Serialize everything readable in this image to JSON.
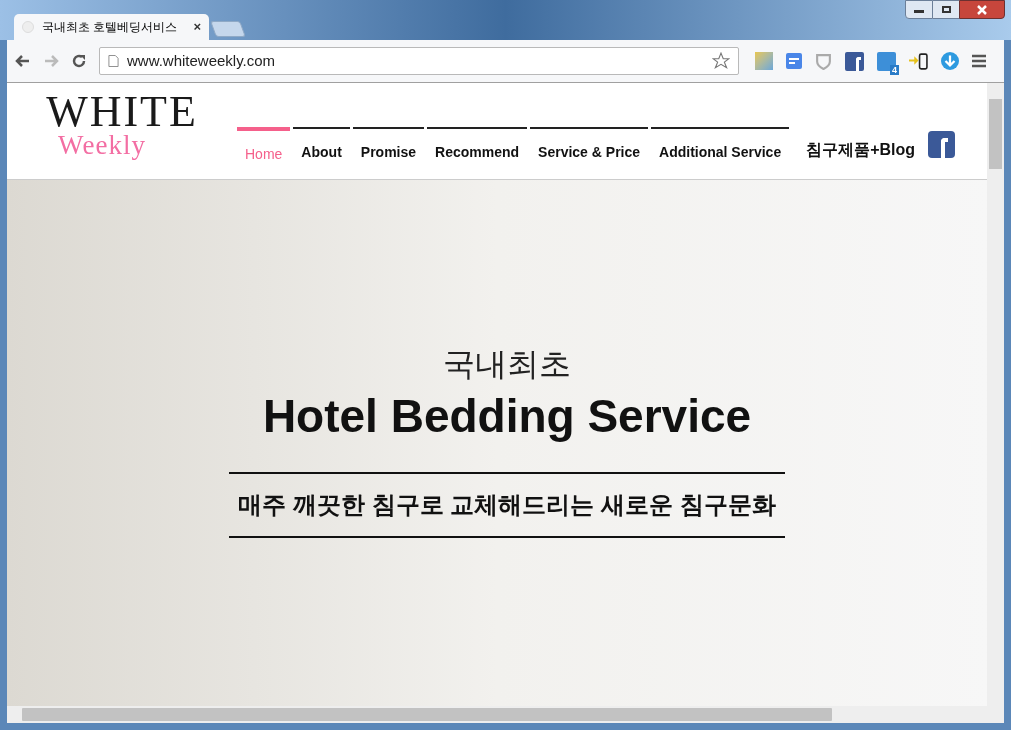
{
  "browser": {
    "tab_title": "국내최초 호텔베딩서비스",
    "tab_close": "×",
    "address": "www.whiteweekly.com",
    "twitter_badge": "4"
  },
  "logo": {
    "title": "WHITE",
    "subtitle": "Weekly"
  },
  "nav": [
    {
      "label": "Home",
      "selected": true
    },
    {
      "label": "About",
      "selected": false
    },
    {
      "label": "Promise",
      "selected": false
    },
    {
      "label": "Recommend",
      "selected": false
    },
    {
      "label": "Service & Price",
      "selected": false
    },
    {
      "label": "Additional Service",
      "selected": false
    }
  ],
  "blog_link": "침구제품+Blog",
  "hero": {
    "eyebrow": "국내최초",
    "title": "Hotel Bedding Service",
    "tagline": "매주 깨끗한 침구로 교체해드리는 새로운 침구문화"
  }
}
